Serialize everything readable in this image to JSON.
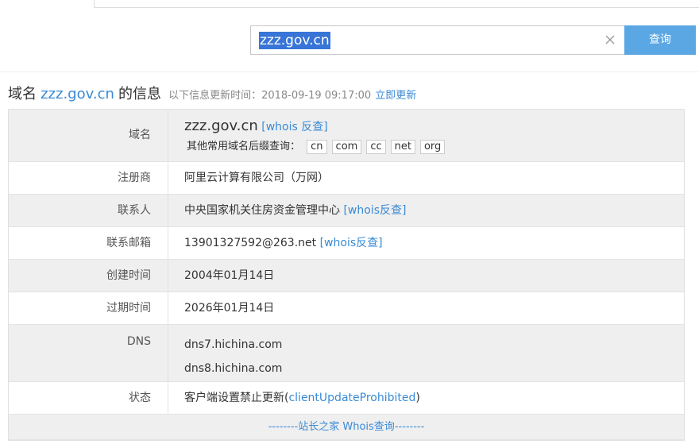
{
  "search": {
    "value": "zzz.gov.cn",
    "button_label": "查询"
  },
  "heading": {
    "prefix": "域名",
    "domain": "zzz.gov.cn",
    "suffix": "的信息",
    "update_info": "以下信息更新时间：2018-09-19 09:17:00",
    "update_link": "立即更新"
  },
  "rows": {
    "domain": {
      "label": "域名",
      "value": "zzz.gov.cn",
      "whois_link": "[whois 反查]",
      "other_suffix_label": "其他常用域名后缀查询：",
      "suffixes": [
        "cn",
        "com",
        "cc",
        "net",
        "org"
      ]
    },
    "registrar": {
      "label": "注册商",
      "value": "阿里云计算有限公司（万网）"
    },
    "contact": {
      "label": "联系人",
      "value": "中央国家机关住房资金管理中心",
      "whois_link": "[whois反查]"
    },
    "email": {
      "label": "联系邮箱",
      "value": "13901327592@263.net",
      "whois_link": "[whois反查]"
    },
    "created": {
      "label": "创建时间",
      "value": "2004年01月14日"
    },
    "expires": {
      "label": "过期时间",
      "value": "2026年01月14日"
    },
    "dns": {
      "label": "DNS",
      "values": [
        "dns7.hichina.com",
        "dns8.hichina.com"
      ]
    },
    "status": {
      "label": "状态",
      "value_prefix": "客户端设置禁止更新(",
      "value_link": "clientUpdateProhibited",
      "value_suffix": ")"
    }
  },
  "footer": {
    "label": "--------站长之家 Whois查询--------"
  }
}
